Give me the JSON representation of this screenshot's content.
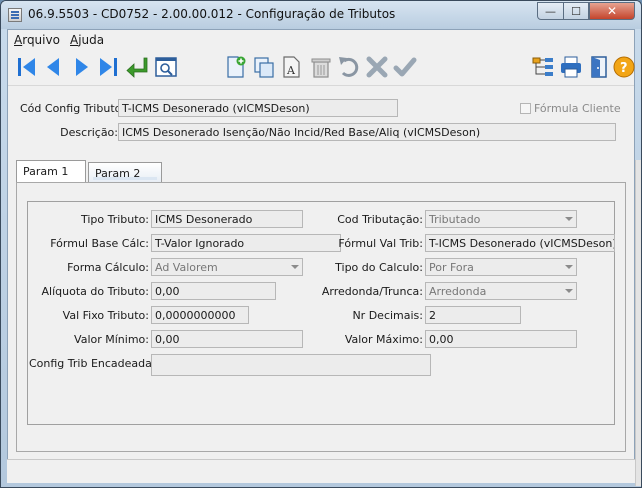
{
  "window": {
    "title": "06.9.5503 - CD0752 - 2.00.00.012 - Configuração de Tributos",
    "min_label": "—",
    "max_label": "☐",
    "close_label": "✕"
  },
  "menu": {
    "items": [
      {
        "first": "A",
        "rest": "rquivo"
      },
      {
        "first": "A",
        "rest": "juda"
      }
    ]
  },
  "toolbar": {
    "icons": [
      "first-record-icon",
      "previous-record-icon",
      "next-record-icon",
      "last-record-icon",
      "return-icon",
      "search-icon",
      "new-document-icon",
      "copy-icon",
      "edit-text-icon",
      "delete-icon",
      "undo-icon",
      "cancel-icon",
      "confirm-icon",
      "tree-icon",
      "print-icon",
      "exit-door-icon",
      "help-icon"
    ]
  },
  "header": {
    "cod_label": "Cód Config Tributo:",
    "cod_value": "T-ICMS Desonerado (vICMSDeson)",
    "formula_label": "Fórmula Cliente",
    "desc_label": "Descrição:",
    "desc_value": "ICMS Desonerado Isenção/Não Incid/Red Base/Aliq  (vICMSDeson)"
  },
  "tabs": [
    {
      "label": "Param 1"
    },
    {
      "label": "Param 2"
    }
  ],
  "form": {
    "tipo_tributo_label": "Tipo Tributo:",
    "tipo_tributo_value": "ICMS Desonerado",
    "cod_tributacao_label": "Cod Tributação:",
    "cod_tributacao_value": "Tributado",
    "formul_base_label": "Fórmul Base Cálc:",
    "formul_base_value": "T-Valor Ignorado",
    "formul_val_label": "Fórmul Val Trib:",
    "formul_val_value": "T-ICMS Desonerado (vICMSDeson)",
    "forma_calculo_label": "Forma Cálculo:",
    "forma_calculo_value": "Ad Valorem",
    "tipo_calculo_label": "Tipo do Calculo:",
    "tipo_calculo_value": "Por Fora",
    "aliquota_label": "Alíquota do Tributo:",
    "aliquota_value": "0,00",
    "arredonda_label": "Arredonda/Trunca:",
    "arredonda_value": "Arredonda",
    "val_fixo_label": "Val Fixo Tributo:",
    "val_fixo_value": "0,0000000000",
    "nr_decimais_label": "Nr Decimais:",
    "nr_decimais_value": "2",
    "valor_minimo_label": "Valor Mínimo:",
    "valor_minimo_value": "0,00",
    "valor_maximo_label": "Valor Máximo:",
    "valor_maximo_value": "0,00",
    "config_trib_label": "Config Trib Encadeada:",
    "config_trib_value": ""
  }
}
